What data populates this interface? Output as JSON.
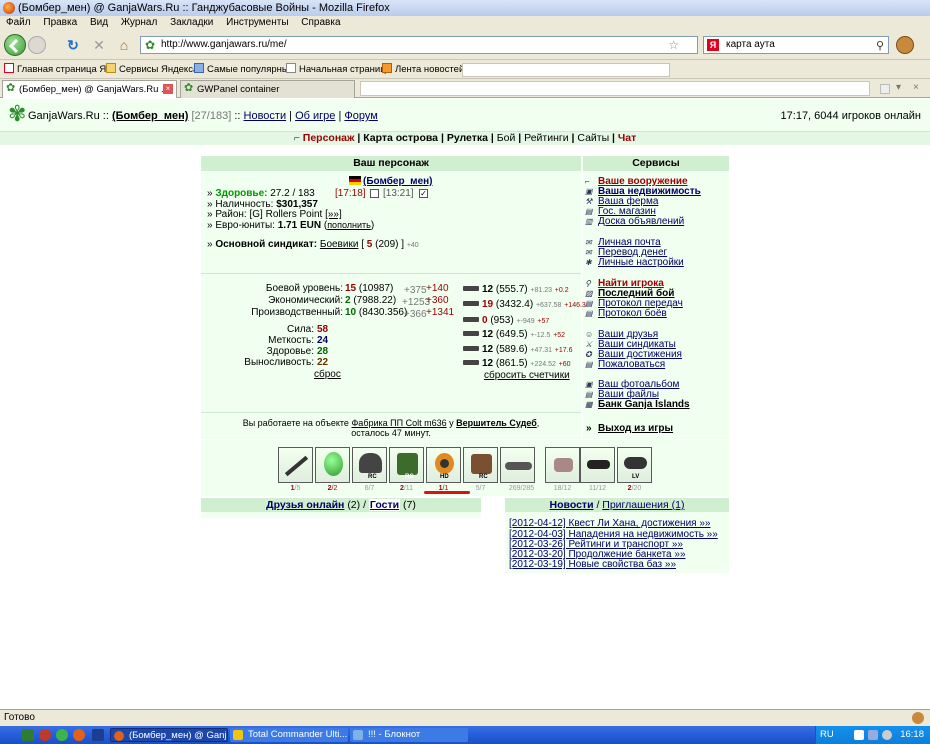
{
  "window": {
    "title": "(Бомбер_мен) @ GanjaWars.Ru :: Ганджубасовые Войны - Mozilla Firefox"
  },
  "menu": [
    "Файл",
    "Правка",
    "Вид",
    "Журнал",
    "Закладки",
    "Инструменты",
    "Справка"
  ],
  "nav": {
    "url": "http://www.ganjawars.ru/me/",
    "search_value": "карта аута",
    "search_engine": "Я"
  },
  "bookmarks": [
    "Главная страница Я...",
    "Сервисы Яндекса",
    "Самые популярные",
    "Начальная страница",
    "Лента новостей"
  ],
  "tabs": [
    {
      "label": "(Бомбер_мен) @ GanjaWars.Ru ..."
    },
    {
      "label": "GWPanel container"
    }
  ],
  "site_header": {
    "logo": "GanjaWars.Ru",
    "sep": "::",
    "user": "(Бомбер_мен)",
    "user_id": "[27/183]",
    "links": [
      "Новости",
      "Об игре",
      "Форум"
    ],
    "online": "17:17, 6044 игроков онлайн"
  },
  "site_menu": [
    "Персонаж",
    "Карта острова",
    "Рулетка",
    "Бой",
    "Рейтинги",
    "Сайты",
    "Чат"
  ],
  "character": {
    "header": "Ваш персонаж",
    "name": "(Бомбер_мен)",
    "health_label": "Здоровье:",
    "health_value": "27.2 / 183",
    "timer1": "[17:18]",
    "timer2": "[13:21]",
    "cash_label": "Наличность:",
    "cash_value": "$301,357",
    "district_label": "Район:",
    "district_value": "[G] Rollers Point",
    "district_more": "[»»]",
    "eun_label": "Евро-юниты:",
    "eun_value": "1.71 EUN",
    "eun_link": "пополнить",
    "syndicate_label": "Основной синдикат:",
    "syndicate_name": "Боевики",
    "syndicate_level": "5",
    "syndicate_points": "(209)",
    "syndicate_extra": "+40"
  },
  "levels": [
    {
      "label": "Боевой уровень:",
      "value": "15",
      "exp": "(10987)",
      "delta": "+375",
      "gain": "+140"
    },
    {
      "label": "Экономический:",
      "value": "2",
      "exp": "(7988.22)",
      "delta": "+1253",
      "gain": "+360"
    },
    {
      "label": "Производственный:",
      "value": "10",
      "exp": "(8430.356)",
      "delta": "+366",
      "gain": "+1341"
    }
  ],
  "attributes": [
    {
      "label": "Сила:",
      "value": "58"
    },
    {
      "label": "Меткость:",
      "value": "24"
    },
    {
      "label": "Здоровье:",
      "value": "28"
    },
    {
      "label": "Выносливость:",
      "value": "22"
    }
  ],
  "attr_reset": "сброс",
  "weapons": [
    {
      "value": "12",
      "exp": "(555.7)",
      "delta": "+81.23",
      "gain": "+0.2"
    },
    {
      "value": "19",
      "exp": "(3432.4)",
      "delta": "+637.58",
      "gain": "+146.3"
    },
    {
      "value": "0",
      "exp": "(953)",
      "delta": "+-949",
      "gain": "+57"
    },
    {
      "value": "12",
      "exp": "(649.5)",
      "delta": "+-12.5",
      "gain": "+52"
    },
    {
      "value": "12",
      "exp": "(589.6)",
      "delta": "+47.31",
      "gain": "+17.6"
    },
    {
      "value": "12",
      "exp": "(861.5)",
      "delta": "+224.52",
      "gain": "+60"
    }
  ],
  "weapons_reset": "сбросить счетчики",
  "work": {
    "prefix": "Вы работаете на объекте",
    "object": "Фабрика ПП Colt m636",
    "mid": "у",
    "owner": "Вершитель Судеб",
    "remain": "осталось 47 минут."
  },
  "services": {
    "header": "Сервисы",
    "group1": [
      "Ваше вооружение",
      "Ваша недвижимость",
      "Ваша ферма",
      "Гос. магазин",
      "Доска объявлений"
    ],
    "group2": [
      "Личная почта",
      "Перевод денег",
      "Личные настройки"
    ],
    "group3": [
      "Найти игрока",
      "Последний бой",
      "Протокол передач",
      "Протокол боёв"
    ],
    "group4": [
      "Ваши друзья",
      "Ваши синдикаты",
      "Ваши достижения",
      "Пожаловаться"
    ],
    "group5": [
      "Ваш фотоальбом",
      "Ваши файлы",
      "Банк Ganja Islands"
    ],
    "exit_arrows": "»",
    "exit": "Выход из игры"
  },
  "inventory": [
    {
      "icon": "shotgun-icon",
      "label_a": "1",
      "label_b": "/5",
      "tag": ""
    },
    {
      "icon": "balloon-icon",
      "label_a": "2",
      "label_b": "/2",
      "tag": ""
    },
    {
      "icon": "helmet-icon",
      "label_a": "",
      "label_b": "6/7",
      "tag": "RC"
    },
    {
      "icon": "vest-icon",
      "label_a": "2",
      "label_b": "/11",
      "tag": "RC"
    },
    {
      "icon": "mask-icon",
      "label_a": "1",
      "label_b": "/1",
      "tag": "HD"
    },
    {
      "icon": "boots-icon",
      "label_a": "",
      "label_b": "5/7",
      "tag": "RC"
    },
    {
      "icon": "helicopter-icon",
      "label_a": "",
      "label_b": "269/285",
      "tag": ""
    },
    {
      "icon": "goat-icon",
      "label_a": "",
      "label_b": "18/12",
      "tag": ""
    },
    {
      "icon": "dumbbell-icon",
      "label_a": "",
      "label_b": "11/12",
      "tag": ""
    },
    {
      "icon": "goggles-icon",
      "label_a": "2",
      "label_b": "/20",
      "tag": "LV"
    }
  ],
  "friends": {
    "online_label": "Друзья онлайн",
    "online_count": "(2)",
    "sep": "/",
    "guests_label": "Гости",
    "guests_count": "(7)"
  },
  "news": {
    "tab_news": "Новости",
    "sep": "/",
    "tab_invites": "Приглашения (1)",
    "items": [
      "[2012-04-12] Квест Ли Хана, достижения »»",
      "[2012-04-03] Нападения на недвижимость »»",
      "[2012-03-26] Рейтинги и транспорт »»",
      "[2012-03-20] Продолжение банкета »»",
      "[2012-03-19] Новые свойства баз »»"
    ]
  },
  "status": {
    "text": "Готово"
  },
  "taskbar": {
    "items": [
      "(Бомбер_мен) @ Ganj...",
      "Total Commander Ulti...",
      "!!! - Блокнот"
    ],
    "lang": "RU",
    "clock": "16:18"
  },
  "colors": {
    "site_bg": "#f0fff0",
    "header_green": "#d0eed0",
    "link_dark": "#000066",
    "accent_red": "#990000"
  }
}
